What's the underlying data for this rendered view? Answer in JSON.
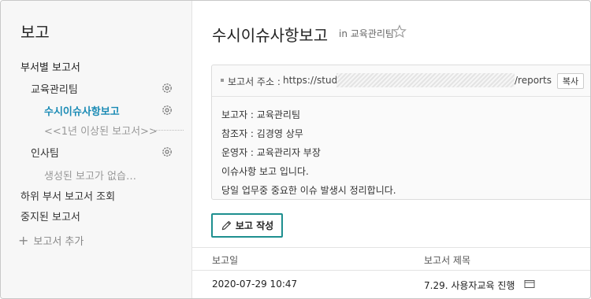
{
  "sidebar": {
    "title": "보고",
    "section_label": "부서별 보고서",
    "items": [
      {
        "label": "교육관리팀"
      },
      {
        "label": "수시이슈사항보고"
      },
      {
        "label": "<<1년 이상된 보고서>>"
      },
      {
        "label": "인사팀"
      },
      {
        "label": "생성된 보고가 없습…"
      },
      {
        "label": "하위 부서 보고서 조회"
      },
      {
        "label": "중지된 보고서"
      }
    ],
    "add_label": "보고서 추가"
  },
  "header": {
    "title": "수시이슈사항보고",
    "in_label": "in 교육관리팀"
  },
  "info": {
    "address_label": "보고서 주소 :",
    "address_prefix": "https://study.",
    "address_suffix": "/reports",
    "copy_label": "복사",
    "lines": [
      "보고자 : 교육관리팀",
      "참조자 : 김경영 상무",
      "운영자 : 교육관리자 부장",
      "이슈사항 보고 입니다.",
      "당일 업무중 중요한 이슈 발생시 정리합니다."
    ]
  },
  "write_button_label": "보고 작성",
  "table": {
    "columns": [
      "보고일",
      "보고서 제목"
    ],
    "rows": [
      {
        "date": "2020-07-29 10:47",
        "title": "7.29. 사용자교육 진행"
      }
    ]
  },
  "colors": {
    "accent": "#1a8bb5",
    "button_border": "#1e8f8f"
  }
}
